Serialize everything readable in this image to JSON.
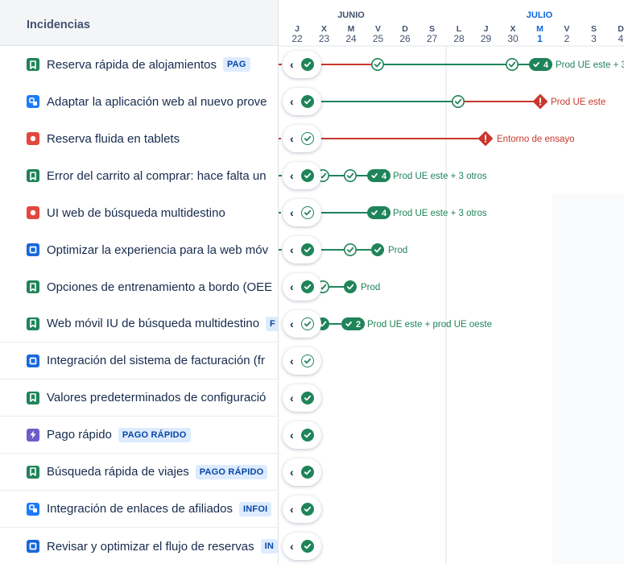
{
  "panel": {
    "title": "Incidencias"
  },
  "months": {
    "june": "JUNIO",
    "july": "JULIO"
  },
  "days": [
    {
      "l": "J",
      "n": "22"
    },
    {
      "l": "X",
      "n": "23"
    },
    {
      "l": "M",
      "n": "24"
    },
    {
      "l": "V",
      "n": "25"
    },
    {
      "l": "D",
      "n": "26"
    },
    {
      "l": "S",
      "n": "27"
    },
    {
      "l": "L",
      "n": "28"
    },
    {
      "l": "J",
      "n": "29"
    },
    {
      "l": "X",
      "n": "30"
    },
    {
      "l": "M",
      "n": "1"
    },
    {
      "l": "V",
      "n": "2"
    },
    {
      "l": "S",
      "n": "3"
    },
    {
      "l": "D",
      "n": "4"
    }
  ],
  "issues": [
    {
      "type": "story",
      "text": "Reserva rápida de alojamientos",
      "tag": "PAG",
      "status": "solid",
      "sep": false
    },
    {
      "type": "subtask",
      "text": "Adaptar la aplicación web al nuevo prove",
      "tag": "",
      "status": "solid",
      "sep": false
    },
    {
      "type": "bug",
      "text": "Reserva fluida en tablets",
      "tag": "",
      "status": "hollow",
      "sep": false
    },
    {
      "type": "story",
      "text": "Error del carrito al comprar: hace falta un",
      "tag": "",
      "status": "solid",
      "sep": false
    },
    {
      "type": "bug",
      "text": "UI web de búsqueda multidestino",
      "tag": "",
      "status": "hollow",
      "sep": false
    },
    {
      "type": "task",
      "text": "Optimizar la experiencia para la web móv",
      "tag": "",
      "status": "solid",
      "sep": false
    },
    {
      "type": "story",
      "text": "Opciones de entrenamiento a bordo (OEE",
      "tag": "",
      "status": "solid",
      "sep": false
    },
    {
      "type": "story",
      "text": "Web móvil IU de búsqueda multidestino",
      "tag": "F",
      "status": "hollow",
      "sep": true
    },
    {
      "type": "task",
      "text": "Integración del sistema de facturación (fr",
      "tag": "",
      "status": "hollow",
      "sep": true
    },
    {
      "type": "story",
      "text": "Valores predeterminados de configuració",
      "tag": "",
      "status": "solid",
      "sep": true
    },
    {
      "type": "epic",
      "text": "Pago rápido",
      "tag": "PAGO RÁPIDO",
      "status": "solid",
      "sep": true
    },
    {
      "type": "story",
      "text": "Búsqueda rápida de viajes",
      "tag": "PAGO RÁPIDO",
      "status": "solid",
      "sep": true
    },
    {
      "type": "subtask",
      "text": "Integración de enlaces de afiliados",
      "tag": "INFOI",
      "status": "solid",
      "sep": true
    },
    {
      "type": "task",
      "text": "Revisar y optimizar el flujo de reservas",
      "tag": "IN",
      "status": "solid",
      "sep": false
    }
  ],
  "labels": {
    "r0": "Prod UE este + 3",
    "r0_count": "4",
    "r1": "Prod UE este",
    "r2": "Entorno de ensayo",
    "r3": "Prod UE este + 3 otros",
    "r3_count": "4",
    "r4": "Prod UE este + 3 otros",
    "r4_count": "4",
    "r5": "Prod",
    "r6": "Prod",
    "r7": "Prod UE este + prod UE oeste",
    "r7_count": "2"
  },
  "colors": {
    "green": "#1f845a",
    "red": "#c9372c",
    "today_blue": "#0c66e4",
    "story": "#1f845a",
    "subtask": "#1d7afc",
    "bug": "#e2483d",
    "task": "#1868db",
    "epic": "#6e5dc6"
  },
  "icons": {
    "story": "bookmark-icon",
    "subtask": "subtask-icon",
    "bug": "bug-icon",
    "task": "task-icon",
    "epic": "lightning-icon",
    "status_done": "check-circle-icon",
    "warning": "warning-icon",
    "nav": "chevron-left-icon"
  }
}
